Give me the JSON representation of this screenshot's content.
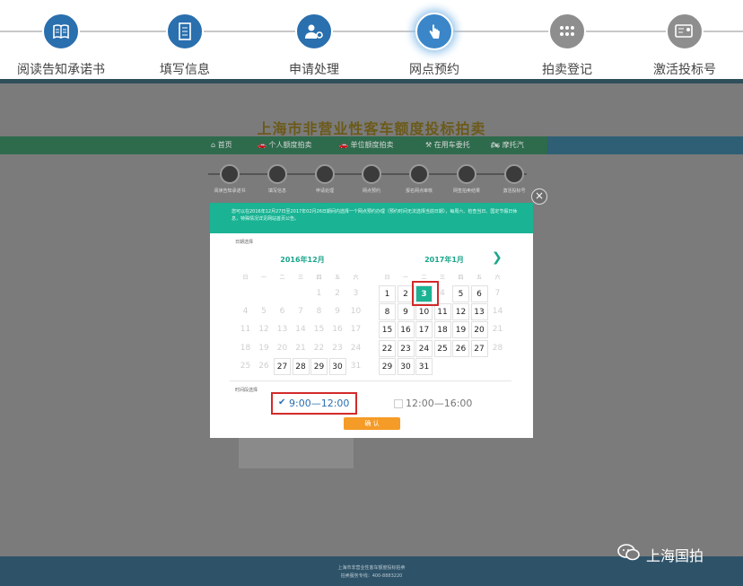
{
  "steps": [
    {
      "label": "阅读告知承诺书",
      "icon": "book-icon",
      "state": "done"
    },
    {
      "label": "填写信息",
      "icon": "form-icon",
      "state": "done"
    },
    {
      "label": "申请处理",
      "icon": "user-gear-icon",
      "state": "done"
    },
    {
      "label": "网点预约",
      "icon": "hand-pointer-icon",
      "state": "active"
    },
    {
      "label": "拍卖登记",
      "icon": "dots-icon",
      "state": "todo"
    },
    {
      "label": "激活投标号",
      "icon": "card-icon",
      "state": "todo"
    }
  ],
  "site": {
    "title": "上海市非营业性客车额度投标拍卖",
    "nav": [
      "首页",
      "个人额度拍卖",
      "单位额度拍卖",
      "在用车委托",
      "摩托汽"
    ]
  },
  "mini_steps": [
    "阅读告知承诺书",
    "填写信息",
    "申请处理",
    "网点预约",
    "报名网点审核",
    "网签拍卖结果",
    "激活投标号"
  ],
  "dialog": {
    "notice": "您可以在2016年12月27日至2017年02月26日期间内选择一个网点预约办理（预约时间无法选择当前日期），每周六、检查当日、国定节假日休息，特殊情况详见网站首页公告。",
    "date_label": "日期选择",
    "weekdays": [
      "日",
      "一",
      "二",
      "三",
      "四",
      "五",
      "六"
    ],
    "months": [
      {
        "title": "2016年12月",
        "weeks": [
          [
            "",
            "",
            "",
            "",
            "1",
            "2",
            "3"
          ],
          [
            "4",
            "5",
            "6",
            "7",
            "8",
            "9",
            "10"
          ],
          [
            "11",
            "12",
            "13",
            "14",
            "15",
            "16",
            "17"
          ],
          [
            "18",
            "19",
            "20",
            "21",
            "22",
            "23",
            "24"
          ],
          [
            "25",
            "26",
            "27",
            "28",
            "29",
            "30",
            "31"
          ]
        ],
        "available": [
          "27",
          "28",
          "29",
          "30"
        ]
      },
      {
        "title": "2017年1月",
        "weeks": [
          [
            "1",
            "2",
            "3",
            "4",
            "5",
            "6",
            "7"
          ],
          [
            "8",
            "9",
            "10",
            "11",
            "12",
            "13",
            "14"
          ],
          [
            "15",
            "16",
            "17",
            "18",
            "19",
            "20",
            "21"
          ],
          [
            "22",
            "23",
            "24",
            "25",
            "26",
            "27",
            "28"
          ],
          [
            "29",
            "30",
            "31",
            "",
            "",
            "",
            ""
          ]
        ],
        "available": [
          "1",
          "2",
          "3",
          "5",
          "6",
          "8",
          "9",
          "10",
          "11",
          "12",
          "13",
          "15",
          "16",
          "17",
          "18",
          "19",
          "20",
          "22",
          "23",
          "24",
          "25",
          "26",
          "27",
          "29",
          "30",
          "31"
        ],
        "selected": "3"
      }
    ],
    "next_icon": "chevron-right-icon",
    "time_label": "时间段选择",
    "slots": [
      {
        "label": "9:00—12:00",
        "checked": true
      },
      {
        "label": "12:00—16:00",
        "checked": false
      }
    ],
    "confirm": "确 认",
    "close": "×"
  },
  "footer": {
    "line1": "上海市非营业性客车额度投标拍卖",
    "line2": "拍卖服务专线：400-8883220"
  },
  "watermark": "上海国拍",
  "colors": {
    "accent": "#1ab394",
    "brand": "#2a6fae",
    "highlight": "#d32a2a",
    "button": "#f59b27"
  }
}
